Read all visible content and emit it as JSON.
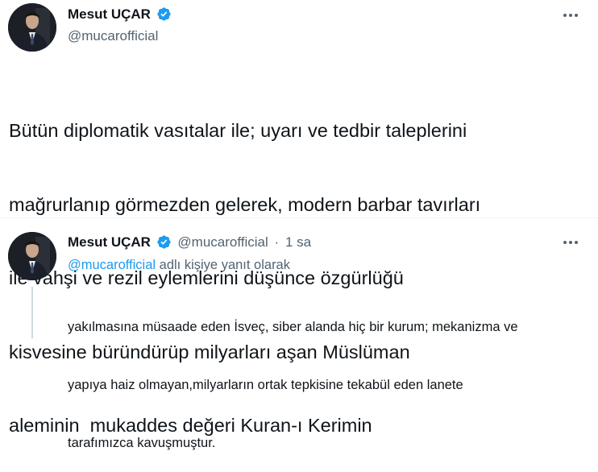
{
  "main_tweet": {
    "author_name": "Mesut UÇAR",
    "author_handle": "@mucarofficial",
    "more_icon": "more-horizontal-icon",
    "text_lines": [
      "Bütün diplomatik vasıtalar ile; uyarı ve tedbir taleplerini",
      "mağrurlanıp görmezden gelerek, modern barbar tavırları",
      "ile vahşi ve rezil eylemlerini düşünce özgürlüğü",
      "kisvesine büründürüp milyarları aşan Müslüman",
      "aleminin  mukaddes değeri Kuran-ı Kerimin"
    ]
  },
  "reply_tweet": {
    "author_name": "Mesut UÇAR",
    "author_handle": "@mucarofficial",
    "separator": "·",
    "timestamp": "1 sa",
    "more_icon": "more-horizontal-icon",
    "reply_to_handle": "@mucarofficial",
    "reply_to_suffix": " adlı kişiye yanıt olarak",
    "text_lines": [
      "yakılmasına müsaade eden İsveç, siber alanda hiç bir kurum; mekanizma ve",
      "yapıya haiz olmayan,milyarların ortak tepkisine tekabül eden lanete",
      "tarafımızca kavuşmuştur."
    ]
  },
  "colors": {
    "text": "#0f1419",
    "secondary": "#536471",
    "link": "#1d9bf0",
    "verified": "#1d9bf0",
    "divider": "#eff3f4",
    "thread_line": "#cfd9de"
  }
}
